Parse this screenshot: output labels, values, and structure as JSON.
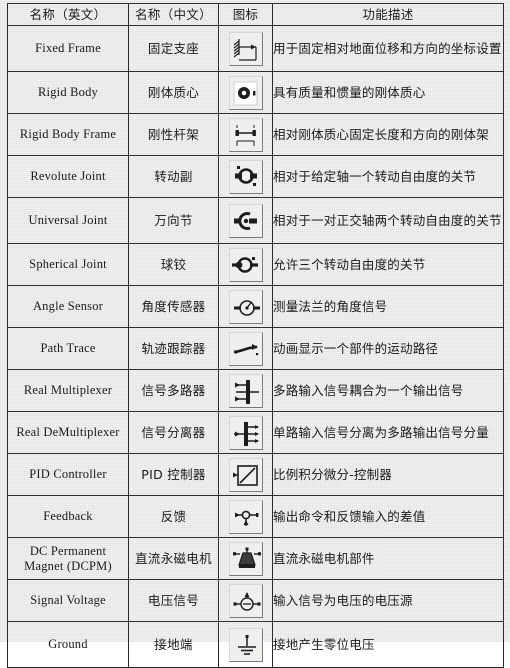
{
  "document": {
    "type": "specification-table",
    "headers": {
      "name_en": "名称（英文）",
      "name_zh": "名称（中文）",
      "icon": "图标",
      "description": "功能描述"
    }
  },
  "rows": [
    {
      "name_en_lines": [
        "Fixed Frame"
      ],
      "name_zh": "固定支座",
      "icon": "fixed-frame-icon",
      "description": "用于固定相对地面位移和方向的坐标设置"
    },
    {
      "name_en_lines": [
        "Rigid Body"
      ],
      "name_zh": "刚体质心",
      "icon": "rigid-body-icon",
      "description": "具有质量和惯量的刚体质心"
    },
    {
      "name_en_lines": [
        "Rigid Body Frame"
      ],
      "name_zh": "刚性杆架",
      "icon": "rigid-body-frame-icon",
      "description": "相对刚体质心固定长度和方向的刚体架"
    },
    {
      "name_en_lines": [
        "Revolute Joint"
      ],
      "name_zh": "转动副",
      "icon": "revolute-joint-icon",
      "description": "相对于给定轴一个转动自由度的关节"
    },
    {
      "name_en_lines": [
        "Universal Joint"
      ],
      "name_zh": "万向节",
      "icon": "universal-joint-icon",
      "description": "相对于一对正交轴两个转动自由度的关节"
    },
    {
      "name_en_lines": [
        "Spherical Joint"
      ],
      "name_zh": "球铰",
      "icon": "spherical-joint-icon",
      "description": "允许三个转动自由度的关节"
    },
    {
      "name_en_lines": [
        "Angle Sensor"
      ],
      "name_zh": "角度传感器",
      "icon": "angle-sensor-icon",
      "description": "测量法兰的角度信号"
    },
    {
      "name_en_lines": [
        "Path Trace"
      ],
      "name_zh": "轨迹跟踪器",
      "icon": "path-trace-icon",
      "description": "动画显示一个部件的运动路径"
    },
    {
      "name_en_lines": [
        "Real Multiplexer"
      ],
      "name_zh": "信号多路器",
      "icon": "real-multiplexer-icon",
      "description": "多路输入信号耦合为一个输出信号"
    },
    {
      "name_en_lines": [
        "Real DeMultiplexer"
      ],
      "name_zh": "信号分离器",
      "icon": "real-demultiplexer-icon",
      "description": "单路输入信号分离为多路输出信号分量"
    },
    {
      "name_en_lines": [
        "PID Controller"
      ],
      "name_zh": "PID 控制器",
      "icon": "pid-controller-icon",
      "description": "比例积分微分-控制器"
    },
    {
      "name_en_lines": [
        "Feedback"
      ],
      "name_zh": "反馈",
      "icon": "feedback-icon",
      "description": "输出命令和反馈输入的差值"
    },
    {
      "name_en_lines": [
        "DC Permanent",
        "Magnet (DCPM)"
      ],
      "name_zh": "直流永磁电机",
      "icon": "dc-permanent-magnet-icon",
      "description": "直流永磁电机部件"
    },
    {
      "name_en_lines": [
        "Signal Voltage"
      ],
      "name_zh": "电压信号",
      "icon": "signal-voltage-icon",
      "description": "输入信号为电压的电压源"
    },
    {
      "name_en_lines": [
        "Ground"
      ],
      "name_zh": "接地端",
      "icon": "ground-icon",
      "description": "接地产生零位电压"
    }
  ],
  "colors": {
    "paper": "#f3f3f1",
    "ink": "#1a1a1a",
    "rule": "#2b2b2b",
    "tile_face": "#efefed",
    "tile_shadow": "#7a7a78"
  }
}
